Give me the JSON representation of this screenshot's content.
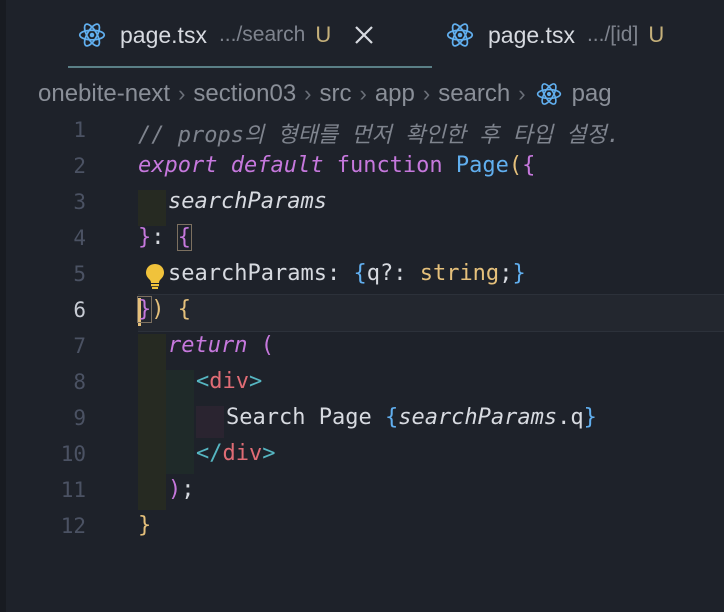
{
  "tabs": [
    {
      "name": "page.tsx",
      "dir": ".../search",
      "badge": "U",
      "active": true
    },
    {
      "name": "page.tsx",
      "dir": ".../[id]",
      "badge": "U",
      "active": false
    }
  ],
  "breadcrumb": [
    "onebite-next",
    "section03",
    "src",
    "app",
    "search",
    "pag"
  ],
  "editor": {
    "active_line": 6,
    "line_numbers": [
      "1",
      "2",
      "3",
      "4",
      "5",
      "6",
      "7",
      "8",
      "9",
      "10",
      "11",
      "12"
    ],
    "lines": {
      "l1": "// props의 형태를 먼저 확인한 후 타입 설정.",
      "l2_export": "export",
      "l2_default": "default",
      "l2_function": "function",
      "l2_name": "Page",
      "l2_paren": "(",
      "l2_brace": "{",
      "l3": "searchParams",
      "l4_brace": "}",
      "l4_colon": ": ",
      "l4_open": "{",
      "l5_name": "searchParams",
      "l5_colon": ": ",
      "l5_open": "{",
      "l5_q": "q",
      "l5_opt": "?: ",
      "l5_type": "string",
      "l5_semi": ";",
      "l5_close": "}",
      "l6_close": "}",
      "l6_paren": ")",
      "l6_open": " {",
      "l7_return": "return",
      "l7_paren": " (",
      "l8_lt": "<",
      "l8_tag": "div",
      "l8_gt": ">",
      "l9_text": "Search Page ",
      "l9_open": "{",
      "l9_expr": "searchParams",
      "l9_dot": ".",
      "l9_q": "q",
      "l9_close": "}",
      "l10_lt": "</",
      "l10_tag": "div",
      "l10_gt": ">",
      "l11_paren": ")",
      "l11_semi": ";",
      "l12_brace": "}"
    }
  },
  "colors": {
    "background": "#1e222a",
    "keyword": "#c678dd",
    "function": "#61afef",
    "string_type": "#e5c07b",
    "tag": "#e06c75",
    "comment": "#7f848e"
  },
  "icons": {
    "tab_icon": "react-icon",
    "close": "close-icon",
    "lightbulb": "lightbulb-icon"
  }
}
